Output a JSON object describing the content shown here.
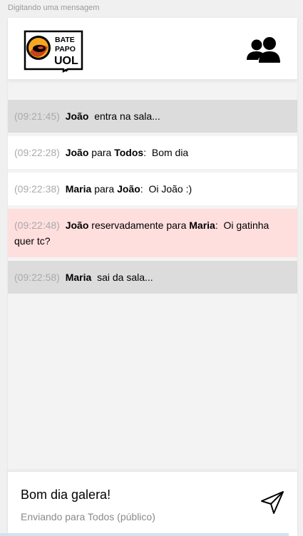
{
  "frame_label": "Digitando uma mensagem",
  "header": {
    "logo_lines": [
      "BATE",
      "PAPO",
      "UOL"
    ],
    "participants_icon": "people-icon"
  },
  "messages": [
    {
      "type": "status",
      "time": "(09:21:45)",
      "from": "João",
      "text": "entra na sala..."
    },
    {
      "type": "normal",
      "time": "(09:22:28)",
      "from": "João",
      "connector": "para",
      "to": "Todos",
      "text": "Bom dia"
    },
    {
      "type": "normal",
      "time": "(09:22:38)",
      "from": "Maria",
      "connector": "para",
      "to": "João",
      "text": "Oi João :)"
    },
    {
      "type": "private",
      "time": "(09:22:48)",
      "from": "João",
      "connector": "reservadamente para",
      "to": "Maria",
      "text": "Oi gatinha quer tc?"
    },
    {
      "type": "status",
      "time": "(09:22:58)",
      "from": "Maria",
      "text": "sai da sala..."
    }
  ],
  "footer": {
    "input_value": "Bom dia galera!",
    "sending_to": "Enviando para Todos (público)",
    "send_icon": "send-icon"
  },
  "colors": {
    "status_bg": "#dcdcdc",
    "normal_bg": "#ffffff",
    "private_bg": "#ffdede",
    "logo_orange": "#f5a623"
  }
}
